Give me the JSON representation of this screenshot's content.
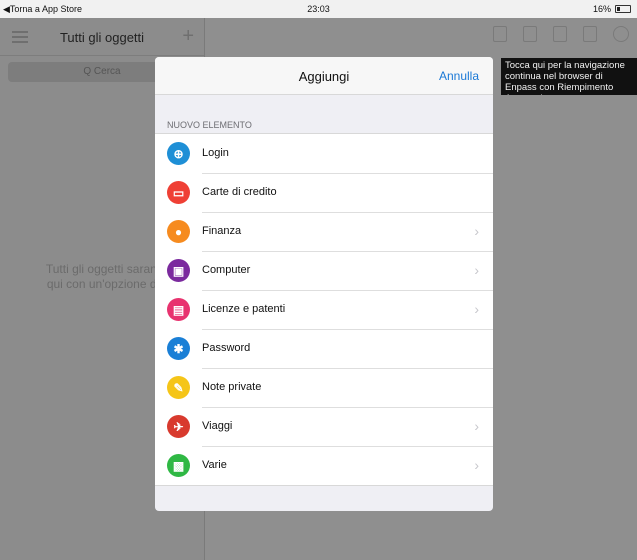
{
  "status_bar": {
    "back_label": "◀Torna a App Store",
    "time": "23:03",
    "battery": "16%"
  },
  "left_pane": {
    "title": "Tutti gli oggetti",
    "search_placeholder": "Q Cerca",
    "empty_line1": "Tutti gli oggetti saranno",
    "empty_line2": "qui con un'opzione di ri"
  },
  "tooltip": {
    "text": "Tocca qui per la navigazione continua nel browser di Enpass con Riempimento Automatico"
  },
  "modal": {
    "title": "Aggiungi",
    "cancel_label": "Annulla",
    "section_header": "NUOVO ELEMENTO",
    "items": [
      {
        "label": "Login",
        "icon": "login-globe-icon",
        "glyph": "⊕",
        "color": "#1e8fd6",
        "chevron": false
      },
      {
        "label": "Carte di credito",
        "icon": "credit-card-icon",
        "glyph": "▭",
        "color": "#ef4035",
        "chevron": false
      },
      {
        "label": "Finanza",
        "icon": "finance-coin-icon",
        "glyph": "●",
        "color": "#f68b1f",
        "chevron": true
      },
      {
        "label": "Computer",
        "icon": "computer-monitor-icon",
        "glyph": "▣",
        "color": "#7b2a9e",
        "chevron": true
      },
      {
        "label": "Licenze e patenti",
        "icon": "license-card-icon",
        "glyph": "▤",
        "color": "#e8336f",
        "chevron": true
      },
      {
        "label": "Password",
        "icon": "password-asterisk-icon",
        "glyph": "✱",
        "color": "#1a7fd6",
        "chevron": false
      },
      {
        "label": "Note private",
        "icon": "note-pencil-icon",
        "glyph": "✎",
        "color": "#f5c518",
        "chevron": false
      },
      {
        "label": "Viaggi",
        "icon": "travel-airplane-icon",
        "glyph": "✈",
        "color": "#d83a2e",
        "chevron": true
      },
      {
        "label": "Varie",
        "icon": "misc-briefcase-icon",
        "glyph": "▩",
        "color": "#2fb844",
        "chevron": true
      }
    ],
    "chevron_glyph": "›"
  }
}
